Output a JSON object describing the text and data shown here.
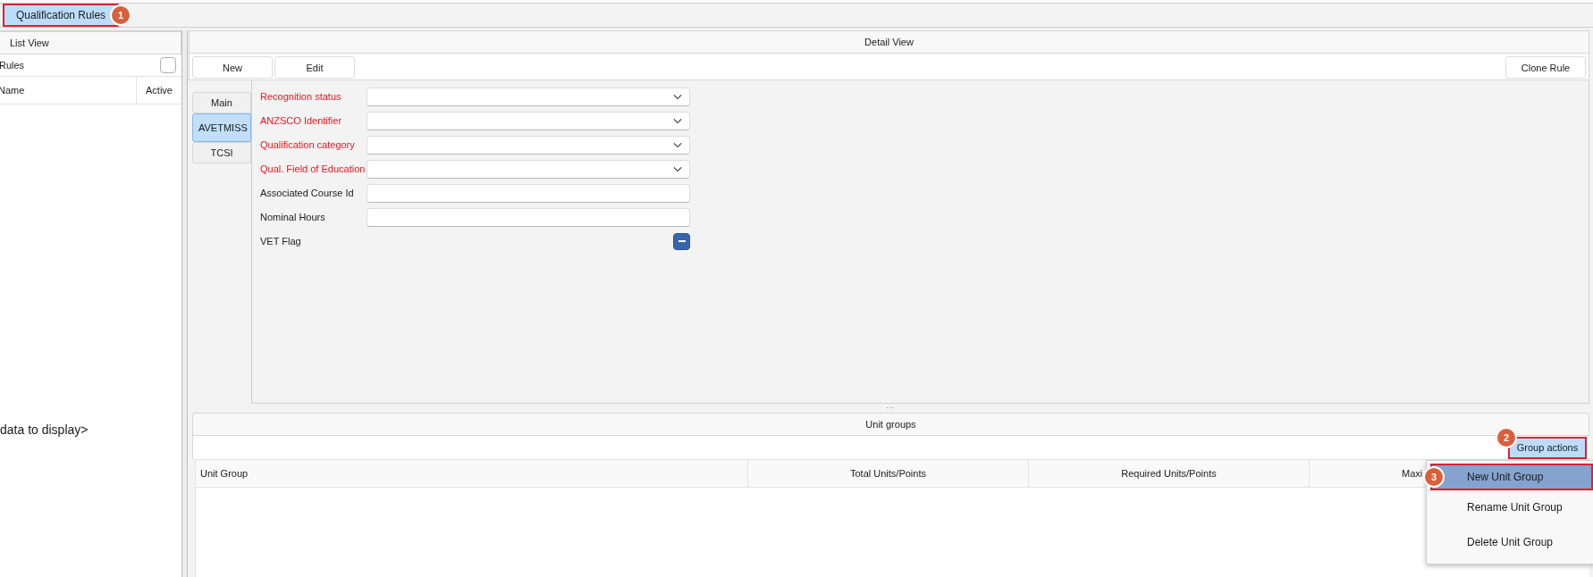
{
  "tabs": [
    {
      "label": "Qualification Rules",
      "selected": true,
      "highlighted": true,
      "badge": "1"
    }
  ],
  "list_view": {
    "title": "List View",
    "filter": {
      "label": "Rules",
      "checked": false
    },
    "columns": [
      "Name",
      "Active"
    ],
    "empty_text": "data to display>"
  },
  "detail_view": {
    "title": "Detail View",
    "toolbar": [
      {
        "label": "New"
      },
      {
        "label": "Edit"
      }
    ],
    "clone_button": "Clone Rule",
    "side_tabs": [
      {
        "label": "Main",
        "selected": false
      },
      {
        "label": "AVETMISS",
        "selected": true
      },
      {
        "label": "TCSI",
        "selected": false
      }
    ],
    "fields": [
      {
        "label": "Recognition status",
        "kind": "dropdown",
        "required": true
      },
      {
        "label": "ANZSCO Identifier",
        "kind": "dropdown",
        "required": true
      },
      {
        "label": "Qualification category",
        "kind": "dropdown",
        "required": true
      },
      {
        "label": "Qual. Field of Education",
        "kind": "dropdown",
        "required": true
      },
      {
        "label": "Associated Course Id",
        "kind": "text",
        "required": false
      },
      {
        "label": "Nominal Hours",
        "kind": "text",
        "required": false
      },
      {
        "label": "VET Flag",
        "kind": "checkbox",
        "required": false,
        "indeterminate": true
      }
    ]
  },
  "unit_groups": {
    "title": "Unit groups",
    "actions_button": {
      "label": "Group actions",
      "highlighted": true,
      "badge": "2"
    },
    "columns": [
      "Unit Group",
      "Total Units/Points",
      "Required Units/Points",
      "Maxi"
    ],
    "menu": [
      {
        "label": "New Unit Group",
        "selected": true,
        "highlighted": true,
        "badge": "3"
      },
      {
        "label": "Rename Unit Group",
        "selected": false,
        "highlighted": false
      },
      {
        "label": "Delete Unit Group",
        "selected": false,
        "highlighted": false
      }
    ]
  }
}
